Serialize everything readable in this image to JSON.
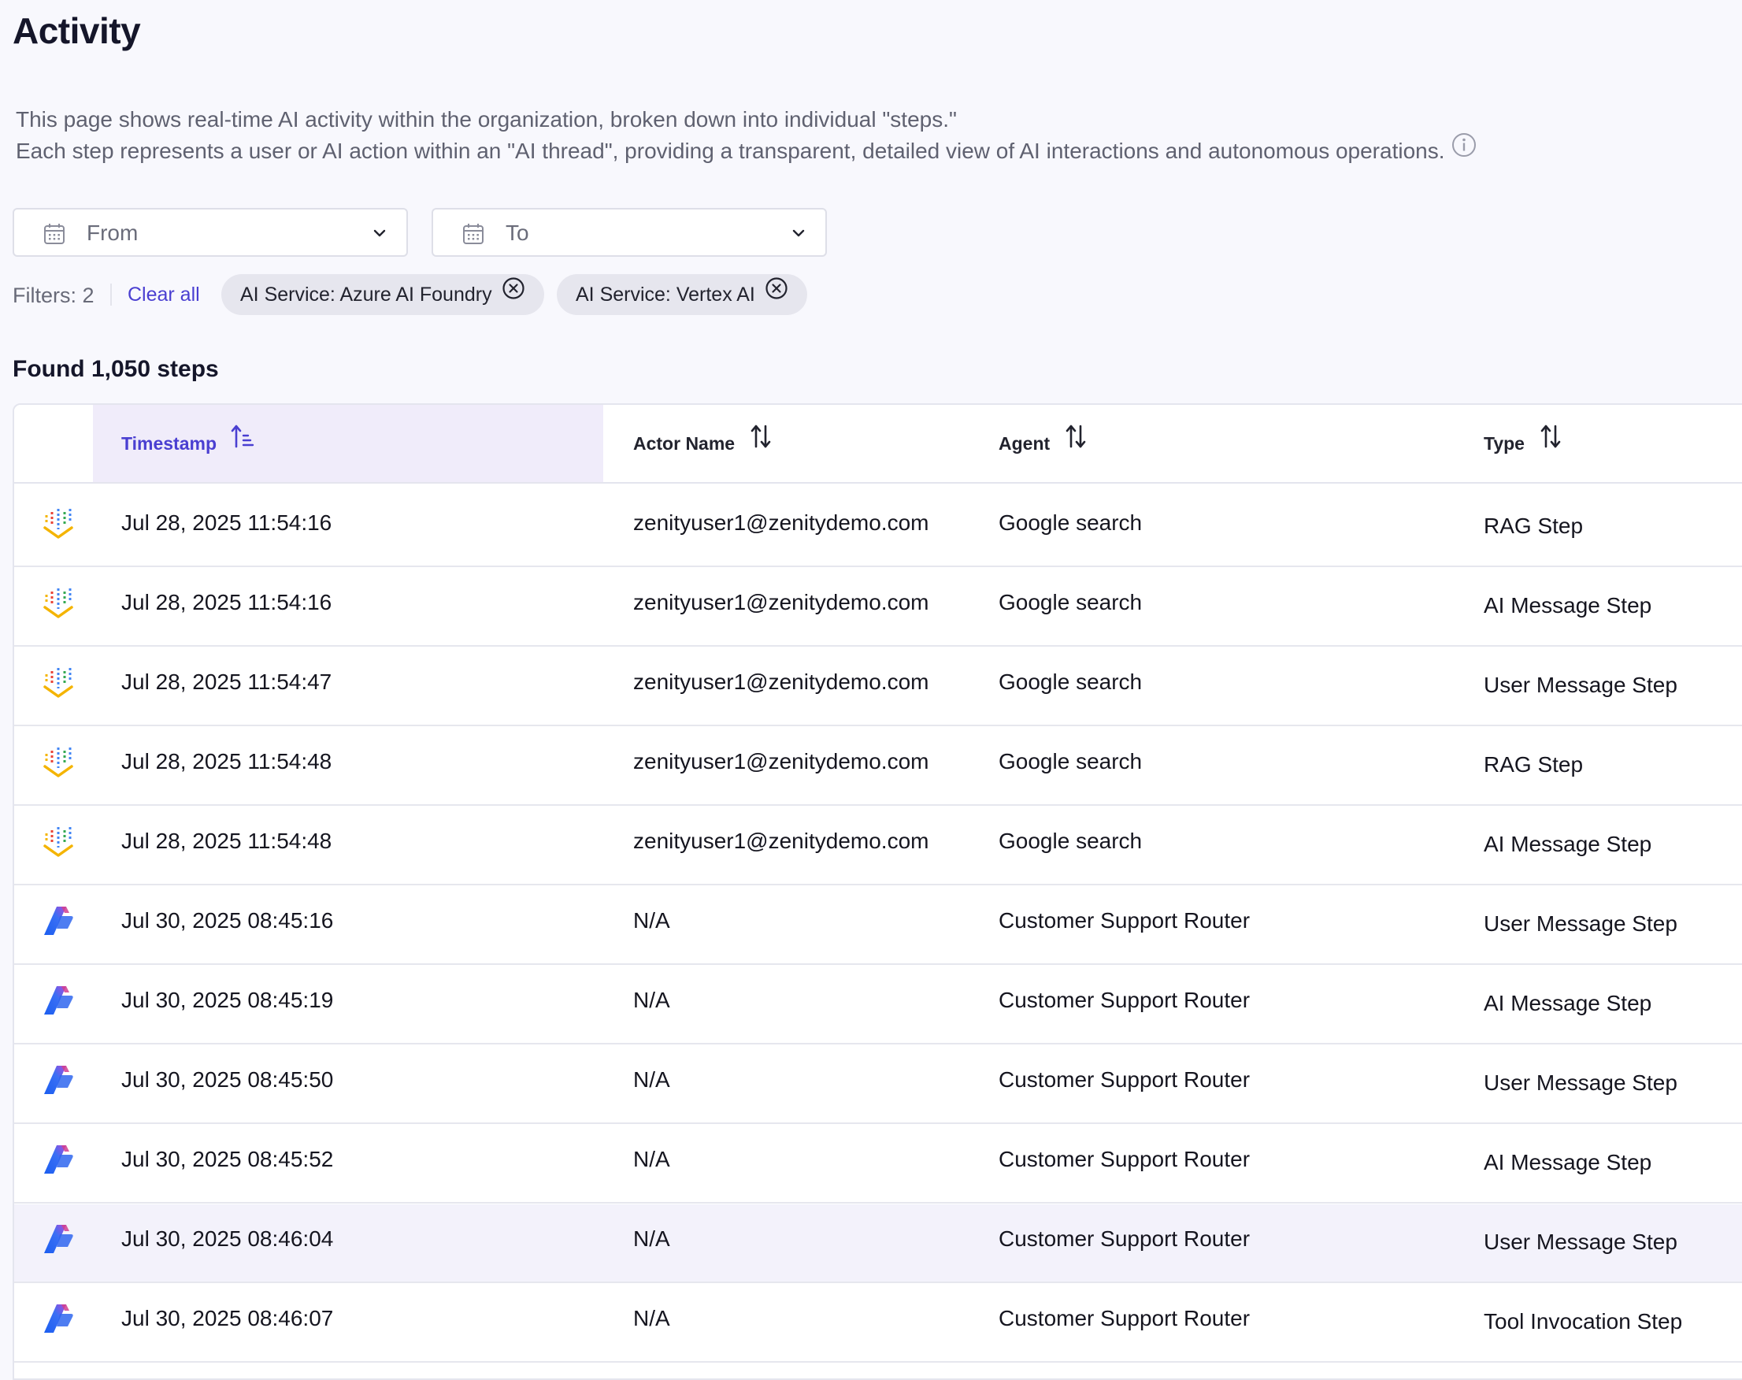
{
  "page": {
    "title": "Activity",
    "description_line1": "This page shows real-time AI activity within the organization, broken down into individual \"steps.\"",
    "description_line2": "Each step represents a user or AI action within an \"AI thread\", providing a transparent, detailed view of AI interactions and autonomous operations."
  },
  "date_range": {
    "from_label": "From",
    "to_label": "To"
  },
  "filters": {
    "count_label": "Filters: 2",
    "clear_all_label": "Clear all",
    "chips": [
      {
        "label": "AI Service: Azure AI Foundry"
      },
      {
        "label": "AI Service: Vertex AI"
      }
    ]
  },
  "results": {
    "found_label": "Found 1,050 steps"
  },
  "table": {
    "columns": {
      "timestamp": "Timestamp",
      "actor_name": "Actor Name",
      "agent": "Agent",
      "type": "Type"
    },
    "sorted_column": "timestamp",
    "rows": [
      {
        "service_icon": "vertex-ai-icon",
        "timestamp": "Jul 28, 2025 11:54:16",
        "actor": "zenityuser1@zenitydemo.com",
        "agent": "Google search",
        "type": "RAG Step"
      },
      {
        "service_icon": "vertex-ai-icon",
        "timestamp": "Jul 28, 2025 11:54:16",
        "actor": "zenityuser1@zenitydemo.com",
        "agent": "Google search",
        "type": "AI Message Step"
      },
      {
        "service_icon": "vertex-ai-icon",
        "timestamp": "Jul 28, 2025 11:54:47",
        "actor": "zenityuser1@zenitydemo.com",
        "agent": "Google search",
        "type": "User Message Step"
      },
      {
        "service_icon": "vertex-ai-icon",
        "timestamp": "Jul 28, 2025 11:54:48",
        "actor": "zenityuser1@zenitydemo.com",
        "agent": "Google search",
        "type": "RAG Step"
      },
      {
        "service_icon": "vertex-ai-icon",
        "timestamp": "Jul 28, 2025 11:54:48",
        "actor": "zenityuser1@zenitydemo.com",
        "agent": "Google search",
        "type": "AI Message Step"
      },
      {
        "service_icon": "azure-ai-foundry-icon",
        "timestamp": "Jul 30, 2025 08:45:16",
        "actor": "N/A",
        "agent": "Customer Support Router",
        "type": "User Message Step"
      },
      {
        "service_icon": "azure-ai-foundry-icon",
        "timestamp": "Jul 30, 2025 08:45:19",
        "actor": "N/A",
        "agent": "Customer Support Router",
        "type": "AI Message Step"
      },
      {
        "service_icon": "azure-ai-foundry-icon",
        "timestamp": "Jul 30, 2025 08:45:50",
        "actor": "N/A",
        "agent": "Customer Support Router",
        "type": "User Message Step"
      },
      {
        "service_icon": "azure-ai-foundry-icon",
        "timestamp": "Jul 30, 2025 08:45:52",
        "actor": "N/A",
        "agent": "Customer Support Router",
        "type": "AI Message Step"
      },
      {
        "service_icon": "azure-ai-foundry-icon",
        "timestamp": "Jul 30, 2025 08:46:04",
        "actor": "N/A",
        "agent": "Customer Support Router",
        "type": "User Message Step"
      },
      {
        "service_icon": "azure-ai-foundry-icon",
        "timestamp": "Jul 30, 2025 08:46:07",
        "actor": "N/A",
        "agent": "Customer Support Router",
        "type": "Tool Invocation Step"
      }
    ]
  },
  "colors": {
    "accent": "#4a3fd1",
    "page_background": "#f8f8fd",
    "active_column_background": "#f0ecfa",
    "chip_background": "#e6e6ee",
    "hover_row_background": "#f3f2fb"
  }
}
